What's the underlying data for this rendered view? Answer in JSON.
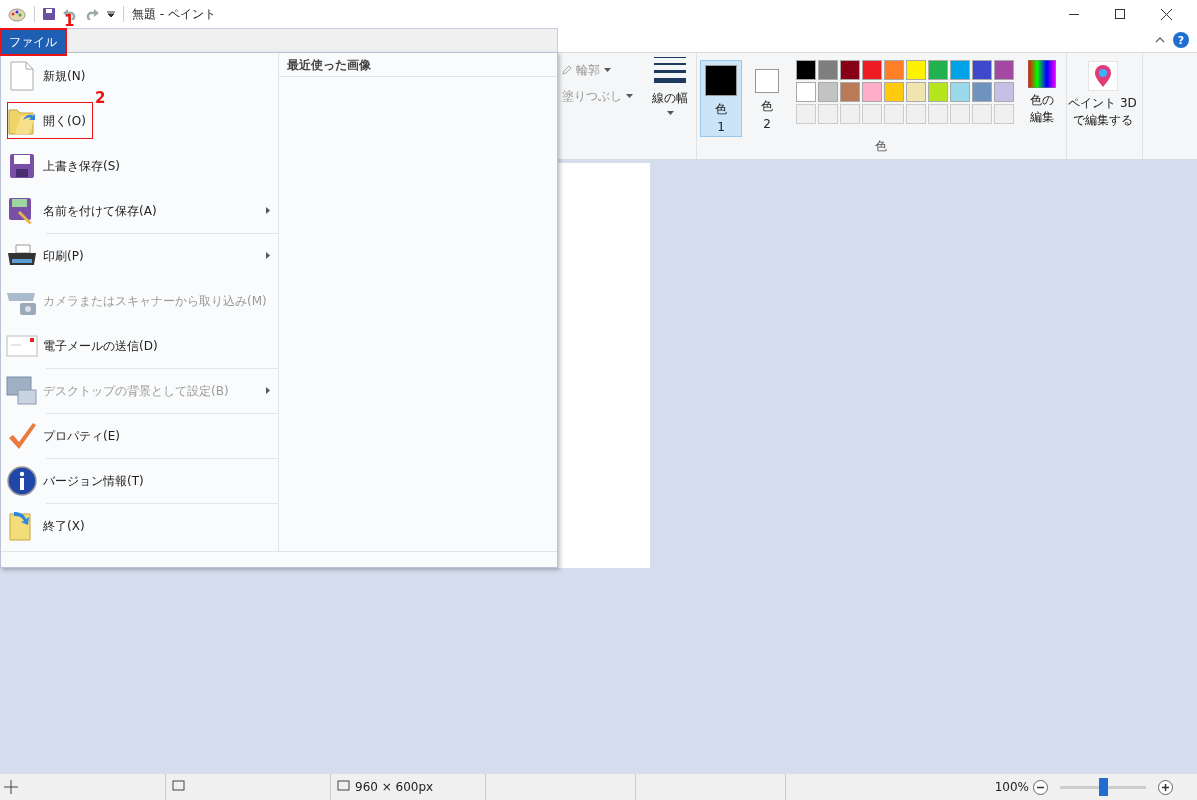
{
  "window": {
    "title": "無題 - ペイント"
  },
  "help_button": {
    "label": "?"
  },
  "file_tab": {
    "label": "ファイル",
    "selected": true,
    "callout": "1"
  },
  "file_menu": {
    "items": [
      {
        "label": "新規(N)",
        "disabled": false,
        "submenu": false,
        "separator_before": false
      },
      {
        "label": "開く(O)",
        "disabled": false,
        "submenu": false,
        "separator_before": false,
        "callout": "2"
      },
      {
        "label": "上書き保存(S)",
        "disabled": false,
        "submenu": false,
        "separator_before": false
      },
      {
        "label": "名前を付けて保存(A)",
        "disabled": false,
        "submenu": true,
        "separator_before": false
      },
      {
        "label": "印刷(P)",
        "disabled": false,
        "submenu": true,
        "separator_before": true
      },
      {
        "label": "カメラまたはスキャナーから取り込み(M)",
        "disabled": true,
        "submenu": false,
        "separator_before": false
      },
      {
        "label": "電子メールの送信(D)",
        "disabled": false,
        "submenu": false,
        "separator_before": false
      },
      {
        "label": "デスクトップの背景として設定(B)",
        "disabled": true,
        "submenu": true,
        "separator_before": true
      },
      {
        "label": "プロパティ(E)",
        "disabled": false,
        "submenu": false,
        "separator_before": true
      },
      {
        "label": "バージョン情報(T)",
        "disabled": false,
        "submenu": false,
        "separator_before": true
      },
      {
        "label": "終了(X)",
        "disabled": false,
        "submenu": false,
        "separator_before": true
      }
    ],
    "recent_heading": "最近使った画像"
  },
  "ribbon": {
    "outline": "輪郭",
    "fill": "塗りつぶし",
    "line_width": "線の幅",
    "color1": {
      "label": "色",
      "sub": "1",
      "selected": true
    },
    "color2": {
      "label": "色",
      "sub": "2",
      "selected": false
    },
    "palette": [
      {
        "color": "#000000"
      },
      {
        "color": "#7f7f7f"
      },
      {
        "color": "#880015"
      },
      {
        "color": "#ed1c24"
      },
      {
        "color": "#ff7f27"
      },
      {
        "color": "#fff200"
      },
      {
        "color": "#22b14c"
      },
      {
        "color": "#00a2e8"
      },
      {
        "color": "#3f48cc"
      },
      {
        "color": "#a349a4"
      },
      {
        "color": "#ffffff"
      },
      {
        "color": "#c3c3c3"
      },
      {
        "color": "#b97a57"
      },
      {
        "color": "#ffaec9"
      },
      {
        "color": "#ffc90e"
      },
      {
        "color": "#efe4b0"
      },
      {
        "color": "#b5e61d"
      },
      {
        "color": "#99d9ea"
      },
      {
        "color": "#7092be"
      },
      {
        "color": "#c8bfe7"
      }
    ],
    "edit_colors": [
      "色の",
      "編集"
    ],
    "paint3d": [
      "ペイント 3D",
      "で編集する"
    ],
    "group_label": "色"
  },
  "status_bar": {
    "size": "960 × 600px",
    "zoom": "100%",
    "zoom_slider": {
      "level": 0.5
    }
  }
}
